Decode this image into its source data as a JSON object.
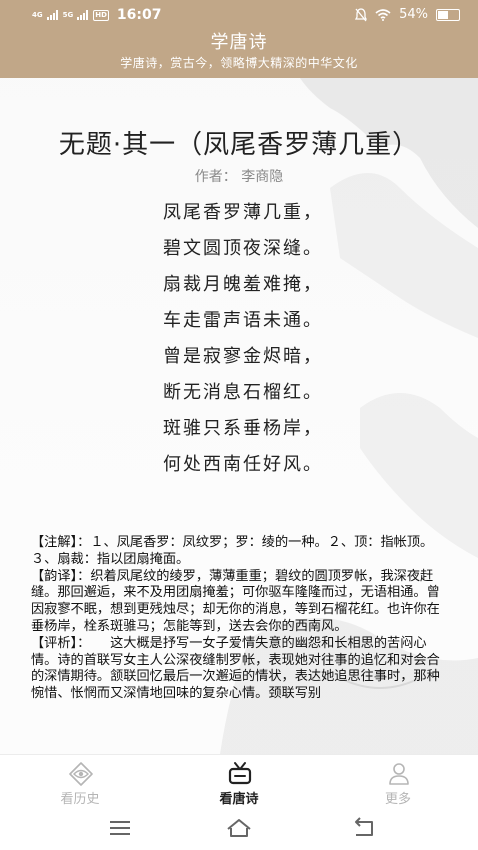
{
  "status_bar": {
    "signal_1": "4G",
    "signal_2": "5G",
    "hd": "HD",
    "time": "16:07",
    "battery": "54%",
    "battery_level": 0.54
  },
  "header": {
    "title": "学唐诗",
    "subtitle": "学唐诗，赏古今，领略博大精深的中华文化"
  },
  "poem": {
    "title": "无题·其一（凤尾香罗薄几重）",
    "author": "作者：  李商隐",
    "lines": [
      "凤尾香罗薄几重，",
      "碧文圆顶夜深缝。",
      "扇裁月魄羞难掩，",
      "车走雷声语未通。",
      "曾是寂寥金烬暗，",
      "断无消息石榴红。",
      "斑骓只系垂杨岸，",
      "何处西南任好风。"
    ]
  },
  "notes": {
    "annotation": "【注解】：１、凤尾香罗：凤纹罗；罗：绫的一种。２、顶：指帐顶。３、扇裁：指以团扇掩面。",
    "translation": "【韵译】：织着凤尾纹的绫罗，薄薄重重；碧纹的圆顶罗帐，我深夜赶缝。那回邂逅，来不及用团扇掩羞；可你驱车隆隆而过，无语相通。曾因寂寥不眠，想到更残烛尽；却无你的消息，等到石榴花红。也许你在垂杨岸，栓系斑骓马；怎能等到，送去会你的西南风。",
    "analysis": "【评析】：　　这大概是抒写一女子爱情失意的幽怨和长相思的苦闷心情。诗的首联写女主人公深夜缝制罗帐，表现她对往事的追忆和对会合的深情期待。颔联回忆最后一次邂逅的情状，表达她追思往事时，那种惋惜、怅惘而又深情地回味的复杂心情。颈联写别"
  },
  "bottom_nav": {
    "items": [
      {
        "label": "看历史",
        "icon": "eye-icon",
        "active": false
      },
      {
        "label": "看唐诗",
        "icon": "tv-icon",
        "active": true
      },
      {
        "label": "更多",
        "icon": "user-icon",
        "active": false
      }
    ]
  },
  "colors": {
    "header_bg": "#c1a788",
    "text": "#222222",
    "muted": "#8a8a8a",
    "nav_inactive": "#b5b5b5"
  }
}
